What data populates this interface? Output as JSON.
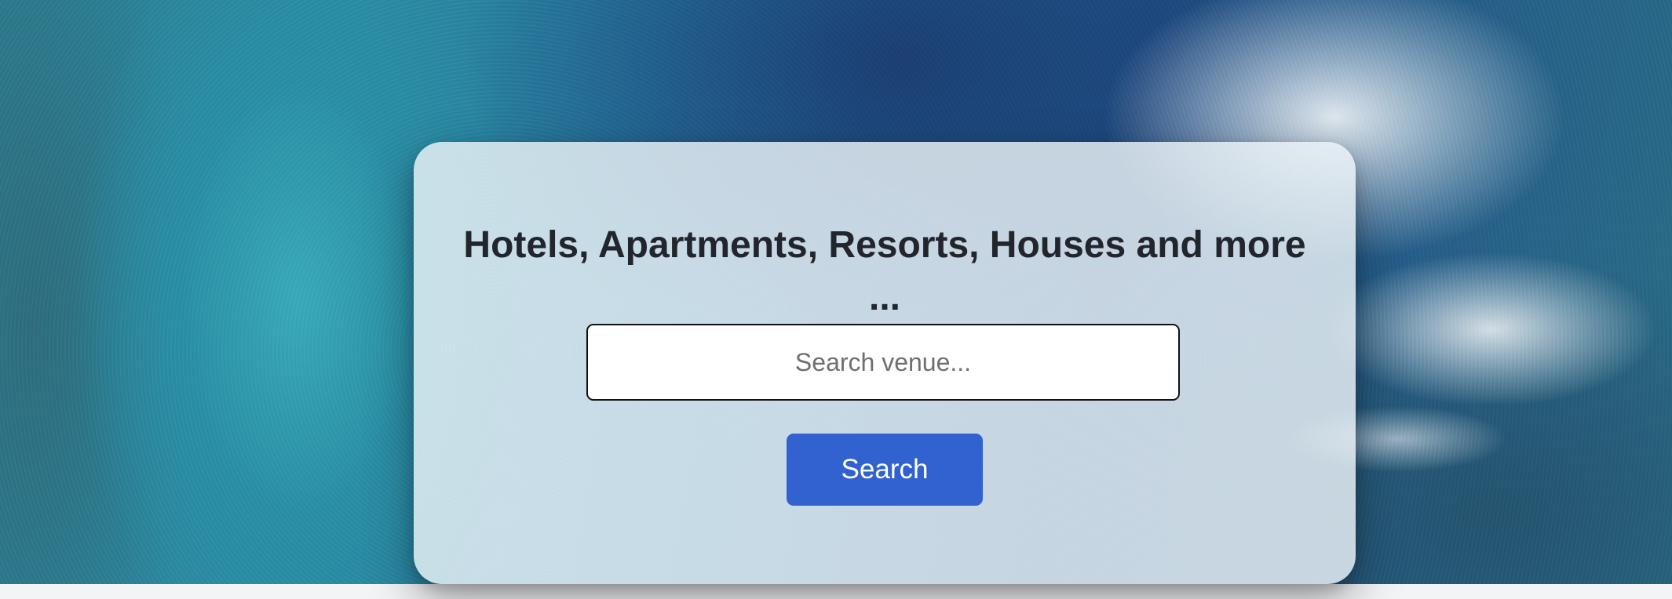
{
  "hero": {
    "title": "Hotels, Apartments, Resorts, Houses and more ...",
    "search": {
      "placeholder": "Search venue...",
      "value": ""
    },
    "search_button_label": "Search"
  },
  "colors": {
    "button_bg": "#3262cf",
    "button_text": "#ffffff",
    "title_text": "#22252b"
  }
}
